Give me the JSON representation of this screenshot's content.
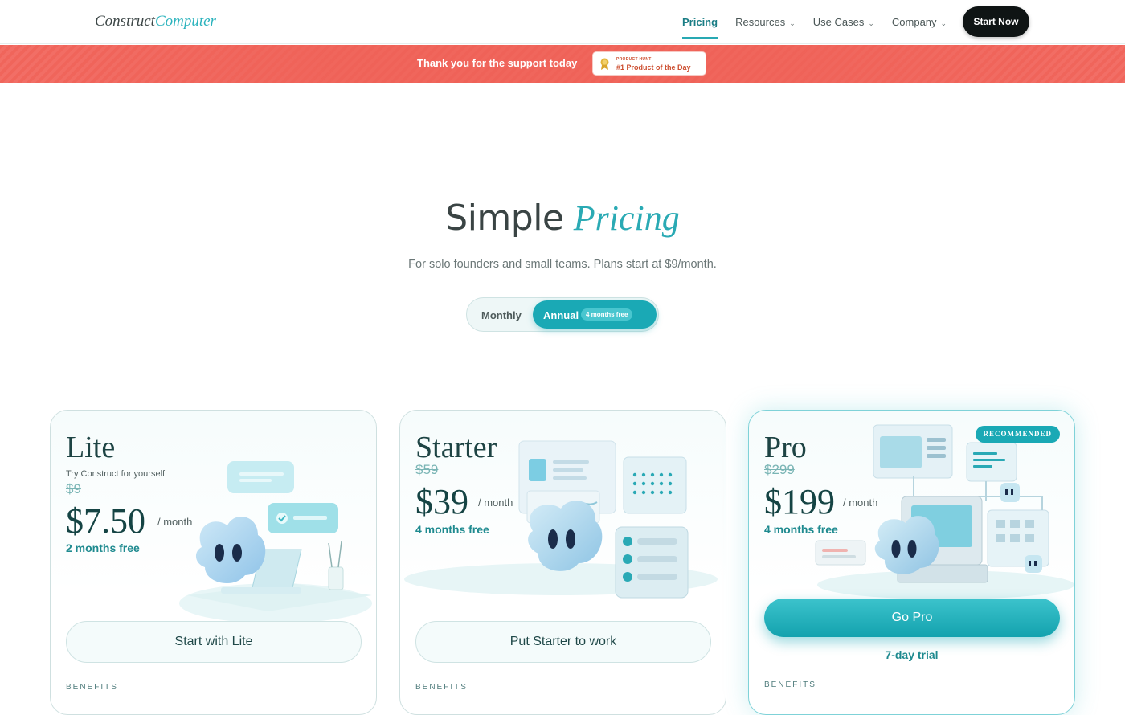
{
  "header": {
    "logo_part1": "Construct",
    "logo_part2": "Computer",
    "nav": [
      {
        "label": "Pricing",
        "active": true
      },
      {
        "label": "Resources",
        "dropdown": true
      },
      {
        "label": "Use Cases",
        "dropdown": true
      },
      {
        "label": "Company",
        "dropdown": true
      }
    ],
    "cta": "Start Now"
  },
  "banner": {
    "text": "Thank you for the support today",
    "badge_small": "PRODUCT HUNT",
    "badge_main": "#1 Product of the Day"
  },
  "hero": {
    "title_plain": "Simple",
    "title_accent": "Pricing",
    "subtitle": "For solo founders and small teams. Plans start at $9/month."
  },
  "billing_toggle": {
    "monthly": "Monthly",
    "annual": "Annual",
    "annual_badge": "4 months free",
    "selected": "Annual"
  },
  "plans": [
    {
      "name": "Lite",
      "description": "Try Construct for yourself",
      "old_price": "$9",
      "price": "$7.50",
      "period": "/ month",
      "free_note": "2 months free",
      "cta": "Start with Lite",
      "benefits_label": "BENEFITS"
    },
    {
      "name": "Starter",
      "old_price": "$59",
      "price": "$39",
      "period": "/ month",
      "free_note": "4 months free",
      "cta": "Put Starter to work",
      "benefits_label": "BENEFITS"
    },
    {
      "name": "Pro",
      "badge": "RECOMMENDED",
      "old_price": "$299",
      "price": "$199",
      "period": "/ month",
      "free_note": "4 months free",
      "cta": "Go Pro",
      "trial": "7-day trial",
      "benefits_label": "BENEFITS"
    }
  ],
  "colors": {
    "accent": "#1aa9b5",
    "banner": "#f0645a",
    "dark_button": "#0f1414"
  }
}
